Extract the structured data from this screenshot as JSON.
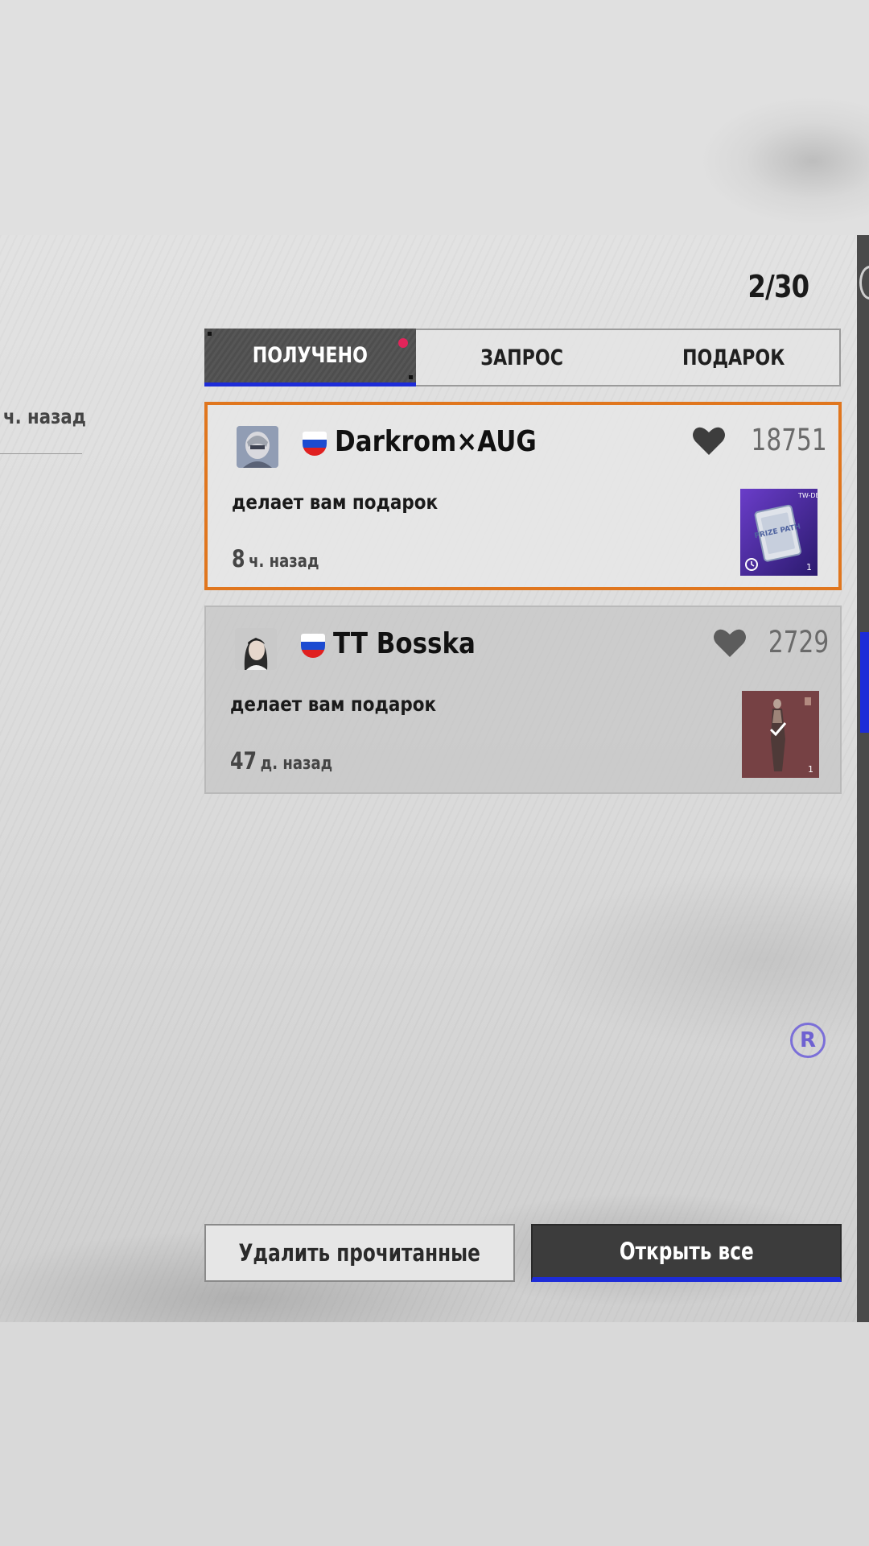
{
  "header": {
    "counter": "2/30"
  },
  "tabs": [
    {
      "label": "ПОЛУЧЕНО",
      "active": true,
      "has_notification": true
    },
    {
      "label": "ЗАПРОС",
      "active": false
    },
    {
      "label": "ПОДАРОК",
      "active": false
    }
  ],
  "left_panel": {
    "time": "ч. назад"
  },
  "gifts": [
    {
      "player": "Darkrom×AUG",
      "flag": "russia-flag-icon",
      "likes": "18751",
      "message": "делает вам подарок",
      "time_value": "8",
      "time_unit": "ч. назад",
      "item_label": "PRIZE PATH",
      "item_count": "1",
      "highlighted": true
    },
    {
      "player": "TT Bosska",
      "flag": "russia-flag-icon",
      "likes": "2729",
      "message": "делает вам подарок",
      "time_value": "47",
      "time_unit": "д. назад",
      "item_count": "1",
      "opened": true
    }
  ],
  "badge": {
    "label": "R"
  },
  "actions": {
    "delete_read": "Удалить прочитанные",
    "open_all": "Открыть все"
  },
  "colors": {
    "accent_blue": "#1d2cd8",
    "highlight_orange": "#e0761e",
    "notification_red": "#e2245a"
  }
}
